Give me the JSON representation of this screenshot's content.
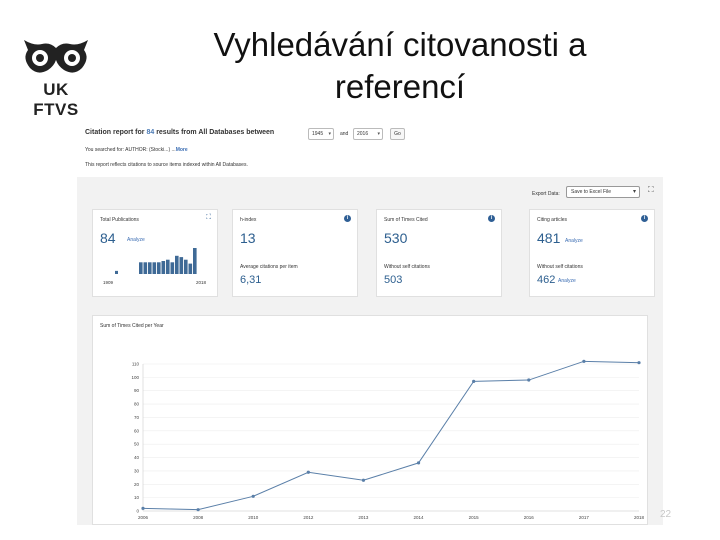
{
  "slide": {
    "title_line1": "Vyhledávání citovanosti a",
    "title_line2": "referencí",
    "logo_text": "UK FTVS",
    "page_number": "22"
  },
  "report": {
    "title_prefix": "Citation report for ",
    "result_count": "84",
    "title_suffix": " results from All Databases  between",
    "from_year": "1945",
    "and_label": "and",
    "to_year": "2016",
    "go_label": "Go",
    "searched_for": "You searched for: AUTHOR: (Stocki...) ...",
    "more_label": "More",
    "note": "This report reflects citations to source items indexed within All Databases."
  },
  "export": {
    "label": "Export Data:",
    "selected": "Save to Excel File"
  },
  "cards": {
    "publications": {
      "label": "Total Publications",
      "value": "84",
      "analyze": "Analyze",
      "year_start": "1909",
      "year_end": "2018",
      "bars": [
        0.12,
        0,
        0,
        0,
        0,
        0,
        0,
        0,
        0,
        0.45,
        0.45,
        0.45,
        0.45,
        0.45,
        0.5,
        0.55,
        0.45,
        0.7,
        0.65,
        0.55,
        0.4,
        1.0
      ]
    },
    "hindex": {
      "label": "h-index",
      "value": "13",
      "sub_label": "Average citations per item",
      "sub_value": "6,31"
    },
    "sum_cited": {
      "label": "Sum of Times Cited",
      "value": "530",
      "sub_label": "Without self citations",
      "sub_value": "503"
    },
    "citing": {
      "label": "Citing articles",
      "value": "481",
      "analyze": "Analyze",
      "sub_label": "Without self citations",
      "sub_value": "462",
      "sub_analyze": "Analyze"
    }
  },
  "chart_data": {
    "type": "line",
    "title": "Sum of Times Cited per Year",
    "ylim": [
      0,
      110
    ],
    "yticks": [
      "0",
      "10",
      "20",
      "30",
      "40",
      "50",
      "60",
      "70",
      "80",
      "90",
      "100",
      "110"
    ],
    "categories": [
      "2006",
      "2008",
      "2010",
      "2012",
      "2013",
      "2014",
      "2015",
      "2016",
      "2017",
      "2018"
    ],
    "values": [
      2,
      1,
      11,
      29,
      23,
      36,
      97,
      98,
      112,
      111
    ],
    "color": "#5a7fa8"
  }
}
